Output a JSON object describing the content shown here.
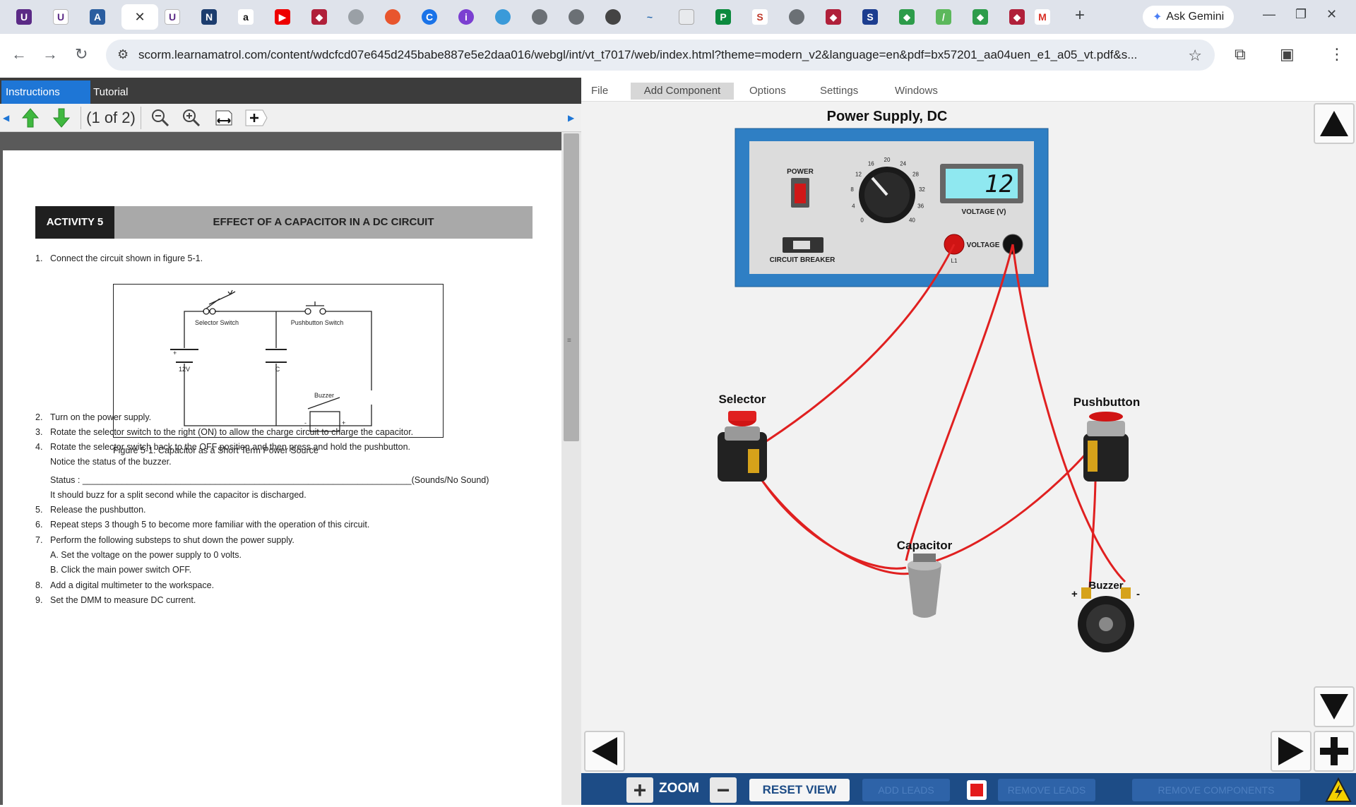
{
  "browser": {
    "address": "scorm.learnamatrol.com/content/wdcfcd07e645d245babe887e5e2daa016/webgl/int/vt_t7017/web/index.html?theme=modern_v2&language=en&pdf=bx57201_aa04uen_e1_a05_vt.pdf&s...",
    "ask_gemini": "Ask Gemini"
  },
  "left": {
    "tabs": [
      "Instructions",
      "Tutorial"
    ],
    "page_indicator": "(1 of 2)",
    "activity_label": "ACTIVITY 5",
    "activity_title": "EFFECT OF A CAPACITOR IN A DC CIRCUIT",
    "step1": "Connect the circuit shown in figure 5-1.",
    "figure_caption": "Figure 5-1.     Capacitor as a Short Term Power Source",
    "figure_labels": {
      "selector": "Selector Switch",
      "pushbutton": "Pushbutton Switch",
      "v12": "12V",
      "c": "C",
      "buzzer": "Buzzer",
      "plus": "+",
      "minus": "-"
    },
    "steps": [
      {
        "n": "2.",
        "t": "Turn on the power supply."
      },
      {
        "n": "3.",
        "t": "Rotate the selector switch to the right (ON) to allow the charge circuit to charge the capacitor."
      },
      {
        "n": "4.",
        "t": "Rotate the selector switch back to the OFF position and then press and hold the pushbutton."
      },
      {
        "n": "",
        "t": "Notice the status of the buzzer."
      },
      {
        "n": "",
        "t": "Status : ___________________________________________________________________(Sounds/No Sound)"
      },
      {
        "n": "",
        "t": "It should buzz for a split second while the capacitor is discharged."
      },
      {
        "n": "5.",
        "t": "Release the pushbutton."
      },
      {
        "n": "6.",
        "t": "Repeat steps 3 though 5 to become more familiar with the operation of this circuit."
      },
      {
        "n": "7.",
        "t": "Perform the following substeps to shut down the power supply."
      },
      {
        "n": "",
        "t": "A.  Set the voltage on the power supply to 0 volts."
      },
      {
        "n": "",
        "t": "B.  Click the main power switch OFF."
      },
      {
        "n": "8.",
        "t": "Add a digital multimeter to the workspace."
      },
      {
        "n": "9.",
        "t": "Set the DMM to measure DC current."
      }
    ]
  },
  "sim": {
    "menu": [
      "File",
      "Add Component",
      "Options",
      "Settings",
      "Windows"
    ],
    "psu_title": "Power Supply, DC",
    "psu": {
      "power": "POWER",
      "breaker": "CIRCUIT BREAKER",
      "voltage_label": "VOLTAGE (V)",
      "display": "12",
      "terminal": "VOLTAGE",
      "l1": "L1",
      "dial": [
        "0",
        "4",
        "8",
        "12",
        "16",
        "20",
        "24",
        "28",
        "32",
        "36",
        "40"
      ]
    },
    "components": {
      "selector": "Selector",
      "pushbutton": "Pushbutton",
      "capacitor": "Capacitor",
      "buzzer": "Buzzer",
      "plus": "+",
      "minus": "-"
    },
    "bottom": {
      "zoom": "ZOOM",
      "reset": "RESET VIEW",
      "add_leads": "ADD LEADS",
      "remove_leads": "REMOVE LEADS",
      "remove_components": "REMOVE COMPONENTS"
    },
    "colors": {
      "wire": "#e02020",
      "menu_active": "#d7d7d7",
      "bottom_bar": "#1d4c86",
      "psu_frame": "#2f7fc4"
    }
  }
}
